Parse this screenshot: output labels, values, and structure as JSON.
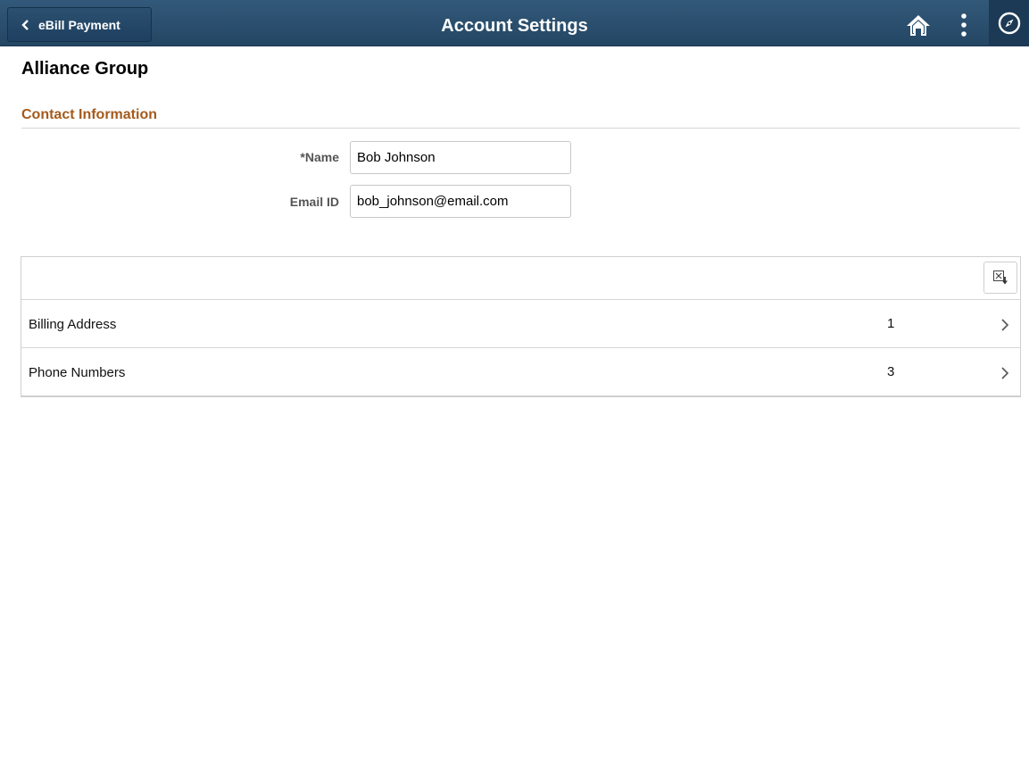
{
  "header": {
    "back_label": "eBill Payment",
    "title": "Account Settings",
    "icons": [
      "chevron-left-icon",
      "home-icon",
      "more-vertical-icon",
      "navigator-compass-icon"
    ],
    "colors": {
      "bar": "#2b5070",
      "accent_section": "#a55a1c"
    }
  },
  "page": {
    "org_name": "Alliance Group"
  },
  "contact": {
    "section_title": "Contact Information",
    "name_label": "*Name",
    "name_value": "Bob Johnson",
    "email_label": "Email ID",
    "email_value": "bob_johnson@email.com"
  },
  "grid": {
    "export_icon": "export-excel-icon",
    "rows": [
      {
        "label": "Billing Address",
        "count": "1"
      },
      {
        "label": "Phone Numbers",
        "count": "3"
      }
    ]
  }
}
